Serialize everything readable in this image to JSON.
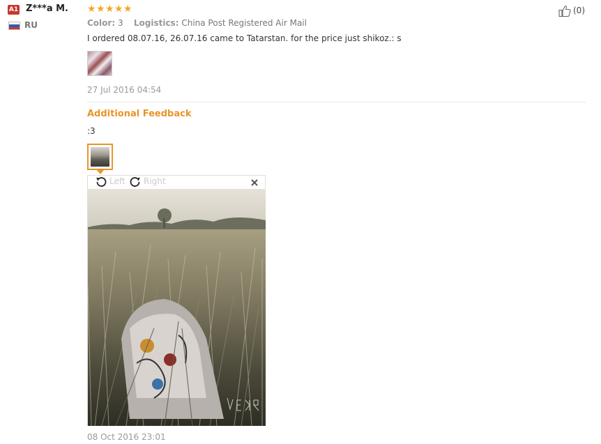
{
  "reviewer": {
    "level_badge": "A1",
    "name": "Z***a M.",
    "country": "RU"
  },
  "review": {
    "rating": 5,
    "color_label": "Color:",
    "color_value": "3",
    "logistics_label": "Logistics:",
    "logistics_value": "China Post Registered Air Mail",
    "text": "I ordered 08.07.16, 26.07.16 came to Tatarstan. for the price just shikoz.: s",
    "date": "27 Jul 2016 04:54",
    "like_count": "(0)"
  },
  "additional": {
    "title": "Additional Feedback",
    "text": ":3",
    "date": "08 Oct 2016 23:01"
  },
  "viewer": {
    "rotate_left_label": "Left",
    "rotate_right_label": "Right"
  },
  "colors": {
    "accent_orange": "#e8952a",
    "star": "#f5a623",
    "badge_red": "#c8382f"
  },
  "icons": [
    "thumbs-up-icon",
    "rotate-left-icon",
    "rotate-right-icon",
    "close-icon",
    "russia-flag-icon"
  ]
}
